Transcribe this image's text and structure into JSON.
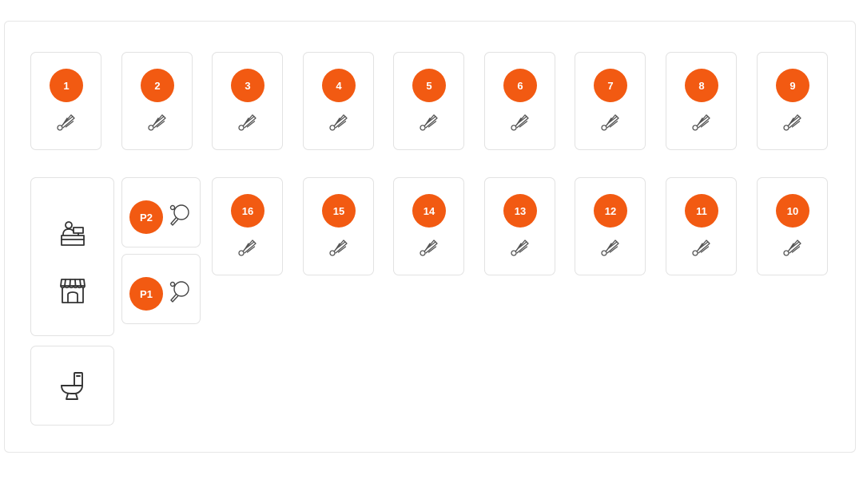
{
  "accent_color": "#f25a12",
  "courts_row1": [
    {
      "label": "1",
      "icon": "shuttlecock-icon"
    },
    {
      "label": "2",
      "icon": "shuttlecock-icon"
    },
    {
      "label": "3",
      "icon": "shuttlecock-icon"
    },
    {
      "label": "4",
      "icon": "shuttlecock-icon"
    },
    {
      "label": "5",
      "icon": "shuttlecock-icon"
    },
    {
      "label": "6",
      "icon": "shuttlecock-icon"
    },
    {
      "label": "7",
      "icon": "shuttlecock-icon"
    },
    {
      "label": "8",
      "icon": "shuttlecock-icon"
    },
    {
      "label": "9",
      "icon": "shuttlecock-icon"
    }
  ],
  "courts_row2": [
    {
      "label": "16",
      "icon": "shuttlecock-icon"
    },
    {
      "label": "15",
      "icon": "shuttlecock-icon"
    },
    {
      "label": "14",
      "icon": "shuttlecock-icon"
    },
    {
      "label": "13",
      "icon": "shuttlecock-icon"
    },
    {
      "label": "12",
      "icon": "shuttlecock-icon"
    },
    {
      "label": "11",
      "icon": "shuttlecock-icon"
    },
    {
      "label": "10",
      "icon": "shuttlecock-icon"
    }
  ],
  "pingpong": [
    {
      "label": "P2",
      "icon": "ping-pong-paddle-icon"
    },
    {
      "label": "P1",
      "icon": "ping-pong-paddle-icon"
    }
  ],
  "facilities": {
    "reception_icon": "reception-desk-icon",
    "shop_icon": "shop-icon",
    "restroom_icon": "toilet-icon"
  }
}
